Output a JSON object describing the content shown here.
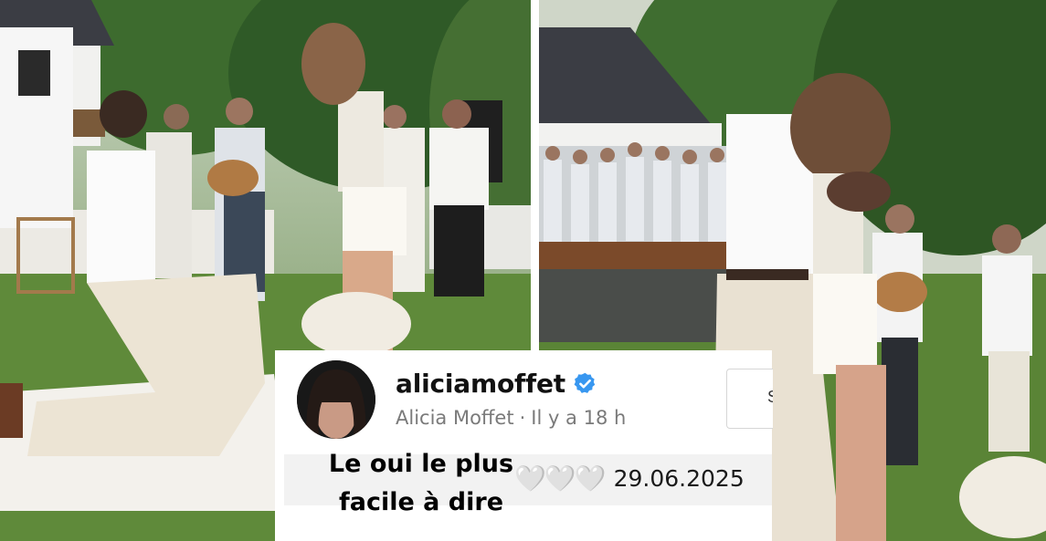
{
  "post": {
    "username": "aliciamoffet",
    "display_name": "Alicia Moffet",
    "time_ago": "Il y a 18 h",
    "separator": "·",
    "caption_line1": "Le oui le plus",
    "caption_line2": "facile à dire",
    "hearts": "🤍🤍🤍",
    "date": "29.06.2025",
    "follow_label": "S"
  },
  "colors": {
    "verified": "#3897f0",
    "grass": "#5f8a3a",
    "trees": "#2f5a27",
    "roof": "#3b3d44"
  },
  "icons": {
    "verified": "verified-badge-icon"
  }
}
